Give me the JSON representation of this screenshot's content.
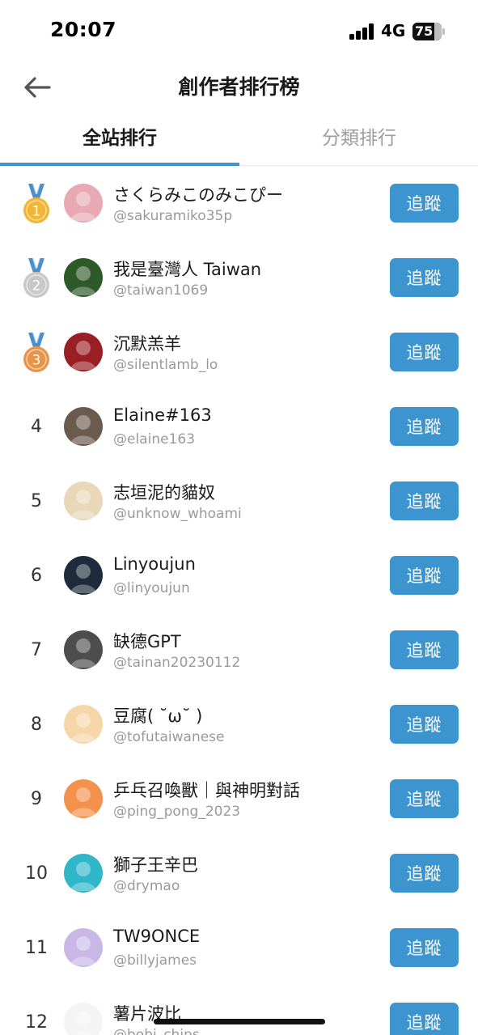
{
  "status_bar": {
    "time": "20:07",
    "network": "4G",
    "battery_level": "75",
    "battery_fraction": 0.75
  },
  "header": {
    "title": "創作者排行榜",
    "back_icon": "arrow-left-icon"
  },
  "tabs": [
    {
      "label": "全站排行",
      "active": true
    },
    {
      "label": "分類排行",
      "active": false
    }
  ],
  "follow_label": "追蹤",
  "colors": {
    "accent": "#3d95cf",
    "gold": "#f2b632",
    "silver": "#c8c8c8",
    "bronze": "#e8954a",
    "ribbon": "#4a8fcf"
  },
  "creators": [
    {
      "rank": "1",
      "medal": "gold",
      "name": "さくらみこのみこぴー",
      "handle": "@sakuramiko35p",
      "avatar_color": "#e9a9b4"
    },
    {
      "rank": "2",
      "medal": "silver",
      "name": "我是臺灣人 Taiwan",
      "handle": "@taiwan1069",
      "avatar_color": "#2e5a2a"
    },
    {
      "rank": "3",
      "medal": "bronze",
      "name": "沉默羔羊",
      "handle": "@silentlamb_lo",
      "avatar_color": "#9a1f24"
    },
    {
      "rank": "4",
      "medal": "",
      "name": "Elaine#163",
      "handle": "@elaine163",
      "avatar_color": "#6b5a4e"
    },
    {
      "rank": "5",
      "medal": "",
      "name": "志垣泥的貓奴",
      "handle": "@unknow_whoami",
      "avatar_color": "#e8d7b9"
    },
    {
      "rank": "6",
      "medal": "",
      "name": "Linyoujun",
      "handle": "@linyoujun",
      "avatar_color": "#1d2b3a"
    },
    {
      "rank": "7",
      "medal": "",
      "name": "缺德GPT",
      "handle": "@tainan20230112",
      "avatar_color": "#4d4d4d"
    },
    {
      "rank": "8",
      "medal": "",
      "name": "豆腐( ˘ω˘ )",
      "handle": "@tofutaiwanese",
      "avatar_color": "#f6d6a6"
    },
    {
      "rank": "9",
      "medal": "",
      "name": "乒乓召喚獸｜與神明對話",
      "handle": "@ping_pong_2023",
      "avatar_color": "#f4914a"
    },
    {
      "rank": "10",
      "medal": "",
      "name": "獅子王辛巴",
      "handle": "@drymao",
      "avatar_color": "#2fb6c9"
    },
    {
      "rank": "11",
      "medal": "",
      "name": "TW9ONCE",
      "handle": "@billyjames",
      "avatar_color": "#c9b8e6"
    },
    {
      "rank": "12",
      "medal": "",
      "name": "薯片波比",
      "handle": "@bobi_chips",
      "avatar_color": "#f4f4f4"
    }
  ]
}
